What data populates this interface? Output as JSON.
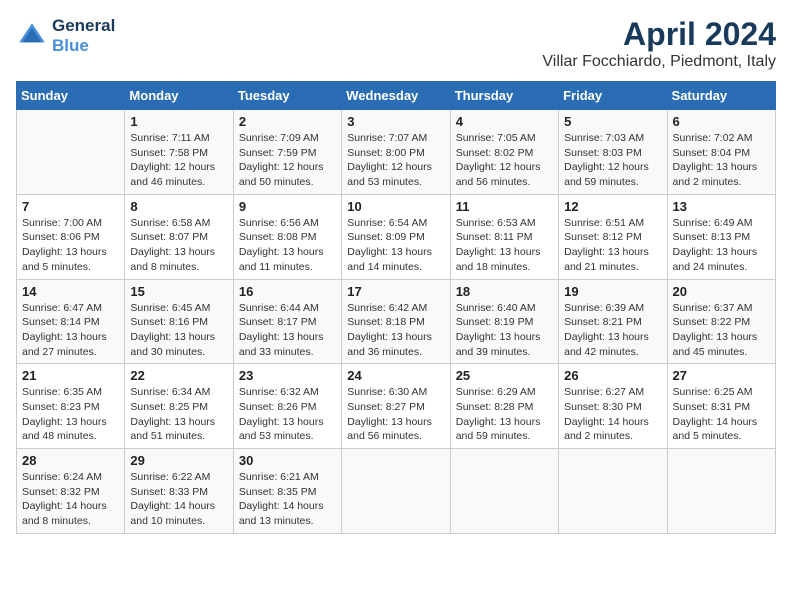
{
  "header": {
    "logo_line1": "General",
    "logo_line2": "Blue",
    "month": "April 2024",
    "location": "Villar Focchiardo, Piedmont, Italy"
  },
  "weekdays": [
    "Sunday",
    "Monday",
    "Tuesday",
    "Wednesday",
    "Thursday",
    "Friday",
    "Saturday"
  ],
  "weeks": [
    [
      {
        "day": "",
        "detail": ""
      },
      {
        "day": "1",
        "detail": "Sunrise: 7:11 AM\nSunset: 7:58 PM\nDaylight: 12 hours\nand 46 minutes."
      },
      {
        "day": "2",
        "detail": "Sunrise: 7:09 AM\nSunset: 7:59 PM\nDaylight: 12 hours\nand 50 minutes."
      },
      {
        "day": "3",
        "detail": "Sunrise: 7:07 AM\nSunset: 8:00 PM\nDaylight: 12 hours\nand 53 minutes."
      },
      {
        "day": "4",
        "detail": "Sunrise: 7:05 AM\nSunset: 8:02 PM\nDaylight: 12 hours\nand 56 minutes."
      },
      {
        "day": "5",
        "detail": "Sunrise: 7:03 AM\nSunset: 8:03 PM\nDaylight: 12 hours\nand 59 minutes."
      },
      {
        "day": "6",
        "detail": "Sunrise: 7:02 AM\nSunset: 8:04 PM\nDaylight: 13 hours\nand 2 minutes."
      }
    ],
    [
      {
        "day": "7",
        "detail": "Sunrise: 7:00 AM\nSunset: 8:06 PM\nDaylight: 13 hours\nand 5 minutes."
      },
      {
        "day": "8",
        "detail": "Sunrise: 6:58 AM\nSunset: 8:07 PM\nDaylight: 13 hours\nand 8 minutes."
      },
      {
        "day": "9",
        "detail": "Sunrise: 6:56 AM\nSunset: 8:08 PM\nDaylight: 13 hours\nand 11 minutes."
      },
      {
        "day": "10",
        "detail": "Sunrise: 6:54 AM\nSunset: 8:09 PM\nDaylight: 13 hours\nand 14 minutes."
      },
      {
        "day": "11",
        "detail": "Sunrise: 6:53 AM\nSunset: 8:11 PM\nDaylight: 13 hours\nand 18 minutes."
      },
      {
        "day": "12",
        "detail": "Sunrise: 6:51 AM\nSunset: 8:12 PM\nDaylight: 13 hours\nand 21 minutes."
      },
      {
        "day": "13",
        "detail": "Sunrise: 6:49 AM\nSunset: 8:13 PM\nDaylight: 13 hours\nand 24 minutes."
      }
    ],
    [
      {
        "day": "14",
        "detail": "Sunrise: 6:47 AM\nSunset: 8:14 PM\nDaylight: 13 hours\nand 27 minutes."
      },
      {
        "day": "15",
        "detail": "Sunrise: 6:45 AM\nSunset: 8:16 PM\nDaylight: 13 hours\nand 30 minutes."
      },
      {
        "day": "16",
        "detail": "Sunrise: 6:44 AM\nSunset: 8:17 PM\nDaylight: 13 hours\nand 33 minutes."
      },
      {
        "day": "17",
        "detail": "Sunrise: 6:42 AM\nSunset: 8:18 PM\nDaylight: 13 hours\nand 36 minutes."
      },
      {
        "day": "18",
        "detail": "Sunrise: 6:40 AM\nSunset: 8:19 PM\nDaylight: 13 hours\nand 39 minutes."
      },
      {
        "day": "19",
        "detail": "Sunrise: 6:39 AM\nSunset: 8:21 PM\nDaylight: 13 hours\nand 42 minutes."
      },
      {
        "day": "20",
        "detail": "Sunrise: 6:37 AM\nSunset: 8:22 PM\nDaylight: 13 hours\nand 45 minutes."
      }
    ],
    [
      {
        "day": "21",
        "detail": "Sunrise: 6:35 AM\nSunset: 8:23 PM\nDaylight: 13 hours\nand 48 minutes."
      },
      {
        "day": "22",
        "detail": "Sunrise: 6:34 AM\nSunset: 8:25 PM\nDaylight: 13 hours\nand 51 minutes."
      },
      {
        "day": "23",
        "detail": "Sunrise: 6:32 AM\nSunset: 8:26 PM\nDaylight: 13 hours\nand 53 minutes."
      },
      {
        "day": "24",
        "detail": "Sunrise: 6:30 AM\nSunset: 8:27 PM\nDaylight: 13 hours\nand 56 minutes."
      },
      {
        "day": "25",
        "detail": "Sunrise: 6:29 AM\nSunset: 8:28 PM\nDaylight: 13 hours\nand 59 minutes."
      },
      {
        "day": "26",
        "detail": "Sunrise: 6:27 AM\nSunset: 8:30 PM\nDaylight: 14 hours\nand 2 minutes."
      },
      {
        "day": "27",
        "detail": "Sunrise: 6:25 AM\nSunset: 8:31 PM\nDaylight: 14 hours\nand 5 minutes."
      }
    ],
    [
      {
        "day": "28",
        "detail": "Sunrise: 6:24 AM\nSunset: 8:32 PM\nDaylight: 14 hours\nand 8 minutes."
      },
      {
        "day": "29",
        "detail": "Sunrise: 6:22 AM\nSunset: 8:33 PM\nDaylight: 14 hours\nand 10 minutes."
      },
      {
        "day": "30",
        "detail": "Sunrise: 6:21 AM\nSunset: 8:35 PM\nDaylight: 14 hours\nand 13 minutes."
      },
      {
        "day": "",
        "detail": ""
      },
      {
        "day": "",
        "detail": ""
      },
      {
        "day": "",
        "detail": ""
      },
      {
        "day": "",
        "detail": ""
      }
    ]
  ]
}
